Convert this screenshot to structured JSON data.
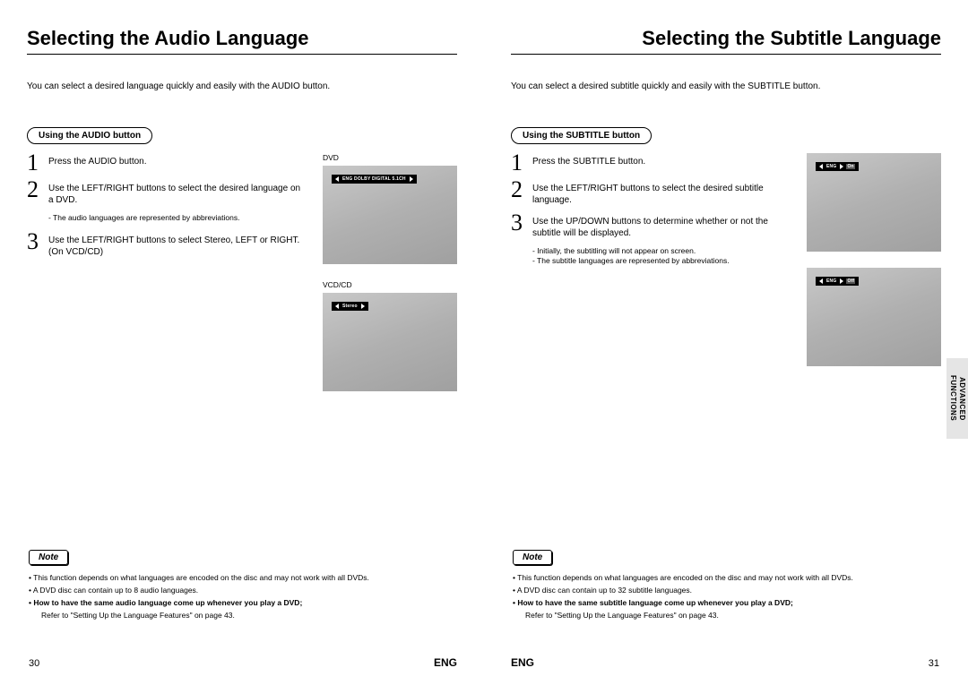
{
  "left": {
    "title": "Selecting the Audio Language",
    "intro": "You can select a desired language quickly and easily with the AUDIO button.",
    "pill": "Using the AUDIO button",
    "steps": [
      {
        "n": "1",
        "text": "Press the AUDIO button."
      },
      {
        "n": "2",
        "text": "Use the LEFT/RIGHT buttons to select the desired language on a DVD."
      },
      {
        "n": "3",
        "text": "Use the LEFT/RIGHT buttons to select Stereo, LEFT or RIGHT. (On VCD/CD)"
      }
    ],
    "step2_sub": "- The audio languages are represented by abbreviations.",
    "fig_dvd_label": "DVD",
    "fig_vcd_label": "VCD/CD",
    "osd_dvd": "ENG DOLBY DIGITAL 5.1CH",
    "osd_vcd": "Stereo",
    "note_label": "Note",
    "notes": [
      "• This function depends on what languages are encoded on the disc and may not work with all DVDs.",
      "• A DVD disc can contain up to 8 audio languages."
    ],
    "note_bold": "• How to have the same audio language come up whenever you play  a DVD;",
    "note_sub": "Refer to \"Setting Up the Language Features\" on page 43.",
    "page_num": "30",
    "lang": "ENG"
  },
  "right": {
    "title": "Selecting the Subtitle Language",
    "intro": "You can select a desired subtitle quickly and easily with the SUBTITLE button.",
    "pill": "Using the SUBTITLE button",
    "steps": [
      {
        "n": "1",
        "text": "Press the SUBTITLE button."
      },
      {
        "n": "2",
        "text": "Use the LEFT/RIGHT buttons to select the desired subtitle language."
      },
      {
        "n": "3",
        "text": "Use the UP/DOWN buttons to determine whether or not the subtitle will be displayed."
      }
    ],
    "step3_subs": [
      "- Initially, the subtitling will not appear on screen.",
      "- The subtitle languages are represented by abbreviations."
    ],
    "osd_on": "ENG",
    "osd_on_state": "On",
    "osd_off": "ENG",
    "osd_off_state": "Off",
    "note_label": "Note",
    "notes": [
      "• This function depends on what languages are encoded on the disc and may not work with all DVDs.",
      "• A DVD disc can contain up to 32 subtitle languages."
    ],
    "note_bold": "• How to have the same subtitle language come up whenever you play  a DVD;",
    "note_sub": "Refer to \"Setting Up the Language Features\" on page 43.",
    "page_num": "31",
    "lang": "ENG",
    "side_tab": "ADVANCED\nFUNCTIONS"
  }
}
